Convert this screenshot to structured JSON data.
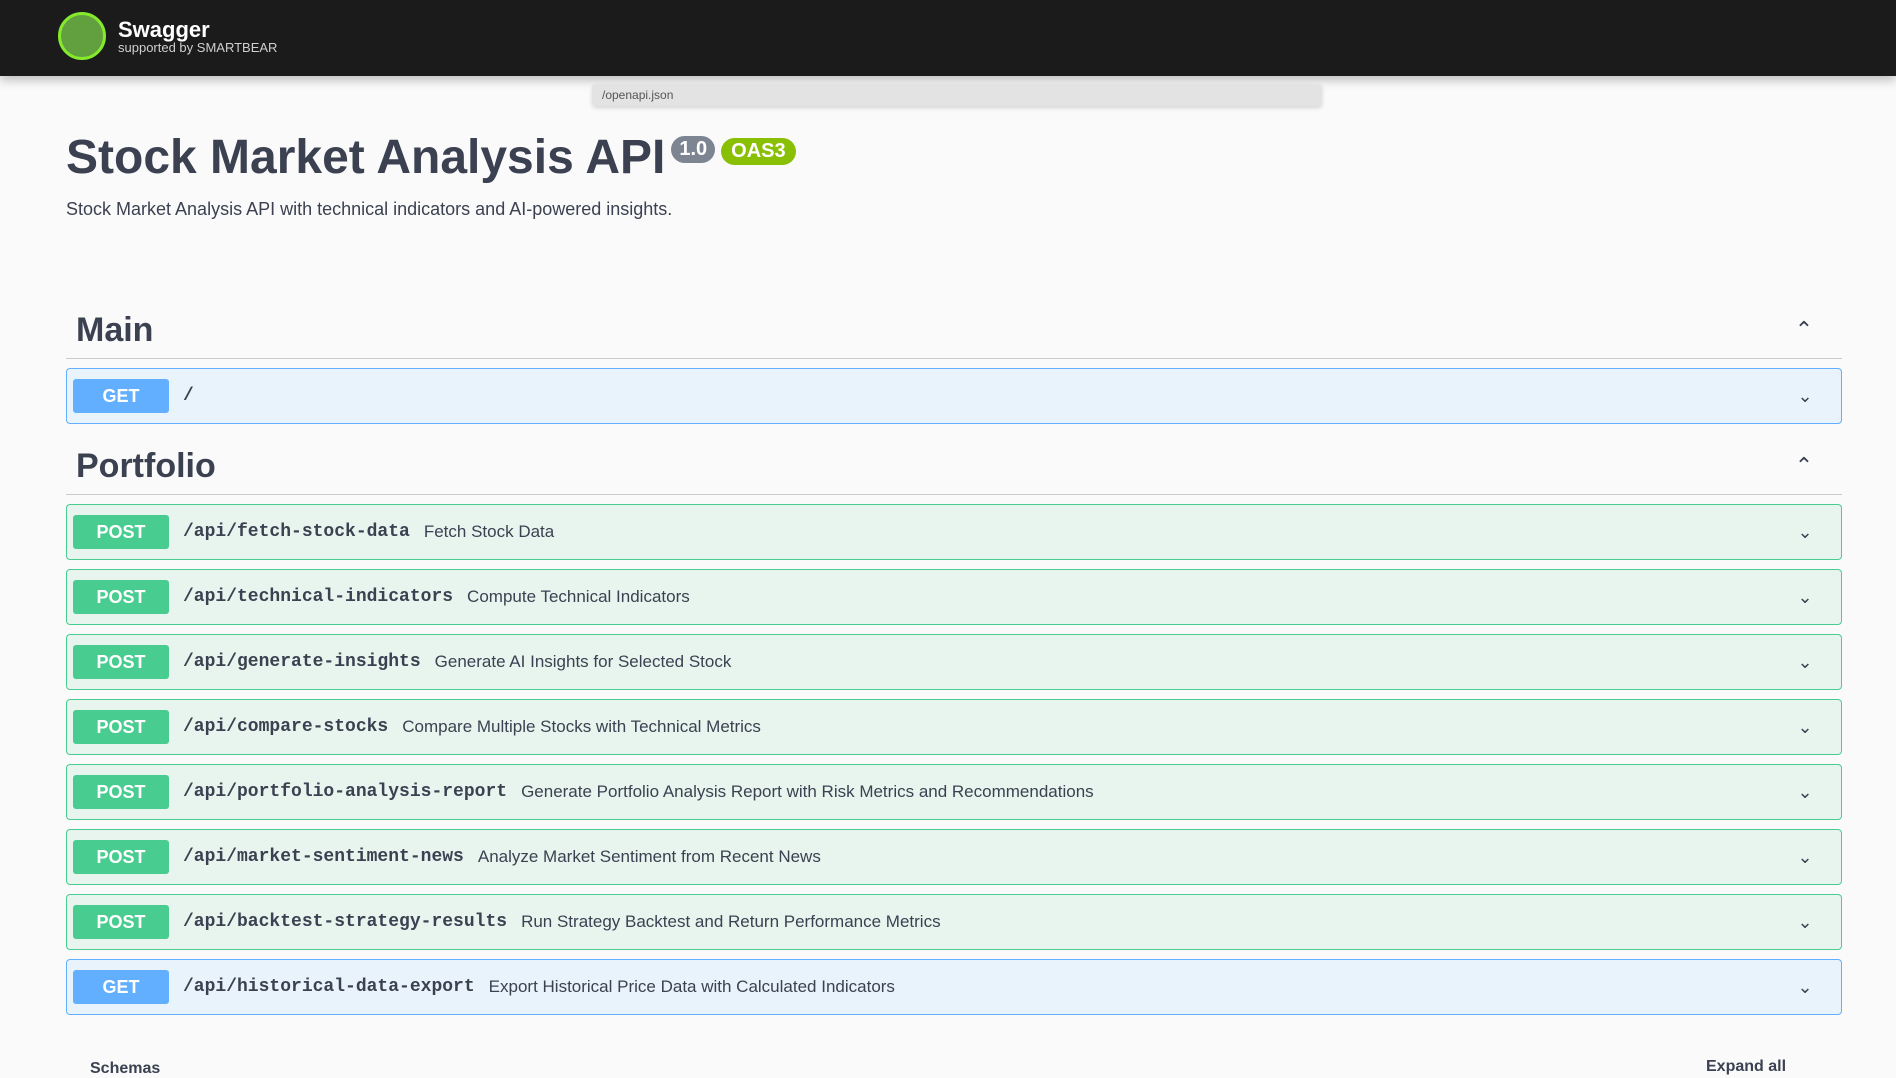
{
  "header": {
    "logo_line1": "Swagger",
    "logo_line2": "supported by SMARTBEAR"
  },
  "url": "/openapi.json",
  "info": {
    "title": "Stock Market Analysis API",
    "version": "1.0",
    "oas": "OAS3",
    "description": "Stock Market Analysis API with technical indicators and AI-powered insights."
  },
  "sections": [
    {
      "name": "Main",
      "operations": [
        {
          "method": "GET",
          "path": "/",
          "summary": ""
        }
      ]
    },
    {
      "name": "Portfolio",
      "operations": [
        {
          "method": "POST",
          "path": "/api/fetch-stock-data",
          "summary": "Fetch Stock Data"
        },
        {
          "method": "POST",
          "path": "/api/technical-indicators",
          "summary": "Compute Technical Indicators"
        },
        {
          "method": "POST",
          "path": "/api/generate-insights",
          "summary": "Generate AI Insights for Selected Stock"
        },
        {
          "method": "POST",
          "path": "/api/compare-stocks",
          "summary": "Compare Multiple Stocks with Technical Metrics"
        },
        {
          "method": "POST",
          "path": "/api/portfolio-analysis-report",
          "summary": "Generate Portfolio Analysis Report with Risk Metrics and Recommendations"
        },
        {
          "method": "POST",
          "path": "/api/market-sentiment-news",
          "summary": "Analyze Market Sentiment from Recent News"
        },
        {
          "method": "POST",
          "path": "/api/backtest-strategy-results",
          "summary": "Run Strategy Backtest and Return Performance Metrics"
        },
        {
          "method": "GET",
          "path": "/api/historical-data-export",
          "summary": "Export Historical Price Data with Calculated Indicators"
        }
      ]
    }
  ],
  "bottom": {
    "left": "Schemas",
    "right": "Expand all"
  }
}
